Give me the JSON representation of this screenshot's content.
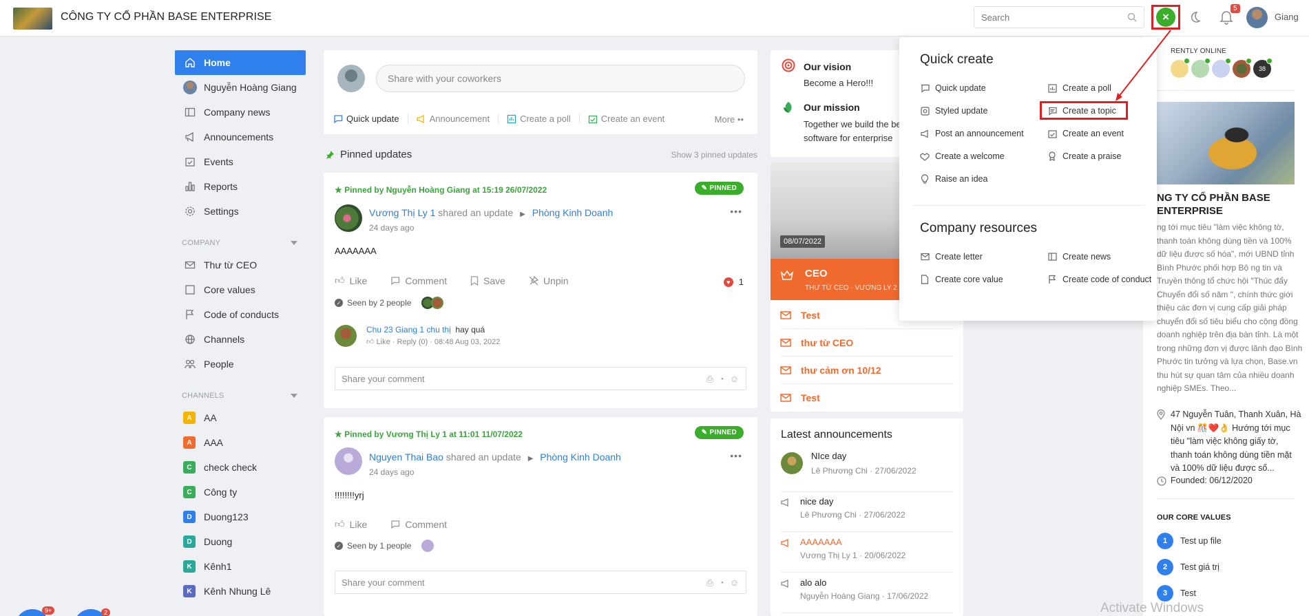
{
  "header": {
    "company": "CÔNG TY CỔ PHẦN BASE ENTERPRISE",
    "search_placeholder": "Search",
    "notification_count": "5",
    "user_name": "Giang"
  },
  "nav": {
    "items": [
      {
        "label": "Home"
      },
      {
        "label": "Nguyễn Hoàng Giang"
      },
      {
        "label": "Company news"
      },
      {
        "label": "Announcements"
      },
      {
        "label": "Events"
      },
      {
        "label": "Reports"
      },
      {
        "label": "Settings"
      }
    ],
    "company_section": "COMPANY",
    "company_items": [
      {
        "label": "Thư từ CEO"
      },
      {
        "label": "Core values"
      },
      {
        "label": "Code of conducts"
      },
      {
        "label": "Channels"
      },
      {
        "label": "People"
      }
    ],
    "channels_section": "CHANNELS",
    "channels": [
      {
        "letter": "A",
        "label": "AA",
        "color": "#f5b400"
      },
      {
        "letter": "A",
        "label": "AAA",
        "color": "#f26b2e"
      },
      {
        "letter": "C",
        "label": "check check",
        "color": "#3aad5b"
      },
      {
        "letter": "C",
        "label": "Công ty",
        "color": "#3aad5b"
      },
      {
        "letter": "D",
        "label": "Duong123",
        "color": "#2f80ed"
      },
      {
        "letter": "D",
        "label": "Duong",
        "color": "#2aa89a"
      },
      {
        "letter": "K",
        "label": "Kênh1",
        "color": "#2aa89a"
      },
      {
        "letter": "K",
        "label": "Kênh Nhung Lê",
        "color": "#5b6bc0"
      }
    ]
  },
  "composer": {
    "placeholder": "Share with your coworkers",
    "actions": [
      "Quick update",
      "Announcement",
      "Create a poll",
      "Create an event"
    ],
    "more": "More"
  },
  "pinned": {
    "title": "Pinned updates",
    "show": "Show 3 pinned updates",
    "badge": "PINNED"
  },
  "posts": [
    {
      "pinned_by": "Pinned by Nguyễn Hoàng Giang at 15:19 26/07/2022",
      "author": "Vương Thị Ly 1",
      "shared": "shared an update",
      "channel": "Phòng Kinh Doanh",
      "time": "24 days ago",
      "body": "AAAAAAA",
      "actions": [
        "Like",
        "Comment",
        "Save",
        "Unpin"
      ],
      "likes": "1",
      "seen": "Seen by 2 people",
      "comment": {
        "author": "Chu 23 Giang 1 chu thị",
        "text": "hay quá",
        "meta": "Like · Reply (0) · 08:48 Aug 03, 2022"
      },
      "comment_placeholder": "Share your comment"
    },
    {
      "pinned_by": "Pinned by Vương Thị Ly 1 at 11:01 11/07/2022",
      "author": "Nguyen Thai Bao",
      "shared": "shared an update",
      "channel": "Phòng Kinh Doanh",
      "time": "24 days ago",
      "body": "!!!!!!!!yrj",
      "actions": [
        "Like",
        "Comment"
      ],
      "seen": "Seen by 1 people",
      "comment_placeholder": "Share your comment"
    }
  ],
  "vision": {
    "title": "Our vision",
    "text": "Become a Hero!!!",
    "mission_title": "Our mission",
    "mission_text_1": "Together we build the be",
    "mission_text_2": "software for enterprise"
  },
  "ceo": {
    "date": "08/07/2022",
    "title": "CEO",
    "subtitle": "THƯ TỪ CEO · VƯƠNG LY 2",
    "items": [
      "Test",
      "thư từ CEO",
      "thư cảm ơn 10/12",
      "Test"
    ]
  },
  "announcements": {
    "title": "Latest announcements",
    "items": [
      {
        "title": "NIce day",
        "meta": "Lê Phương Chi · 27/06/2022"
      },
      {
        "title": "nice day",
        "meta": "Lê Phương Chi · 27/06/2022"
      },
      {
        "title": "AAAAAAA",
        "meta": "Vương Thị Ly 1 · 20/06/2022"
      },
      {
        "title": "alo alo",
        "meta": "Nguyễn Hoàng Giang · 17/06/2022"
      }
    ]
  },
  "quick_create": {
    "title": "Quick create",
    "items": [
      "Quick update",
      "Create a poll",
      "Styled update",
      "Create a topic",
      "Post an announcement",
      "Create an event",
      "Create a welcome",
      "Create a praise",
      "Raise an idea"
    ],
    "resources_title": "Company resources",
    "resources": [
      "Create letter",
      "Create news",
      "Create core value",
      "Create code of conduct"
    ]
  },
  "right": {
    "online_title": "RENTLY ONLINE",
    "online_count": "38",
    "company_name_1": "NG TY CỔ PHẦN BASE",
    "company_name_2": "ENTERPRISE",
    "description": "ng tới mục tiêu \"làm việc không tờ, thanh toán không dùng tiền và 100% dữ liệu được số hóa\", mới UBND tỉnh Bình Phước phối hợp Bộ ng tin và Truyền thông tổ chức hội \"Thúc đẩy Chuyển đổi số năm \", chính thức giới thiệu các đơn vị cung cấp giải pháp chuyển đổi số tiêu biểu cho cộng đồng doanh nghiệp trên địa bàn tỉnh. Là một trong những đơn vị được lãnh đạo Bình Phước tin tưởng và lựa chọn, Base.vn thu hút sự quan tâm của nhiều doanh nghiệp SMEs. Theo...",
    "address": "47 Nguyễn Tuân, Thanh Xuân, Hà Nội vn 🎊❤️👌 Hướng tới mục tiêu \"làm việc không giấy tờ, thanh toán không dùng tiền mặt và 100% dữ liệu được số...",
    "founded": "Founded: 06/12/2020",
    "core_values_title": "OUR CORE VALUES",
    "core_values": [
      "Test up file",
      "Test giá trị",
      "Test"
    ]
  },
  "watermark": "Activate Windows",
  "bottom_badges": [
    "9+",
    "2"
  ],
  "colors": {
    "accent": "#2f80ed",
    "green": "#3aad2b",
    "orange": "#f26b2e",
    "highlight": "#e02020"
  }
}
